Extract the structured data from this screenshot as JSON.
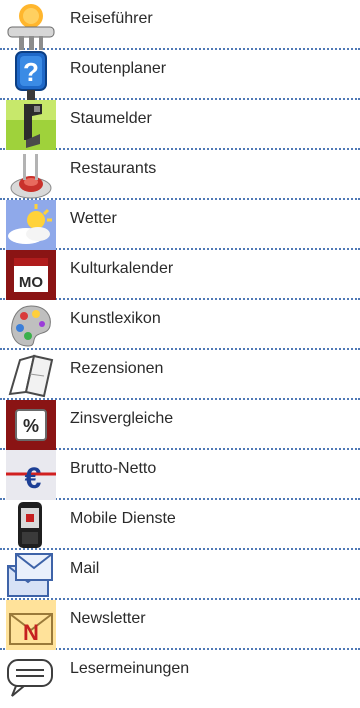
{
  "menu": {
    "items": [
      {
        "label": "Reiseführer",
        "icon": "beach-umbrella-icon"
      },
      {
        "label": "Routenplaner",
        "icon": "signpost-icon"
      },
      {
        "label": "Staumelder",
        "icon": "traffic-jam-icon"
      },
      {
        "label": "Restaurants",
        "icon": "plate-cutlery-icon"
      },
      {
        "label": "Wetter",
        "icon": "sun-cloud-icon"
      },
      {
        "label": "Kulturkalender",
        "icon": "calendar-icon"
      },
      {
        "label": "Kunstlexikon",
        "icon": "paint-palette-icon"
      },
      {
        "label": "Rezensionen",
        "icon": "open-book-icon"
      },
      {
        "label": "Zinsvergleiche",
        "icon": "percent-icon"
      },
      {
        "label": "Brutto-Netto",
        "icon": "euro-icon"
      },
      {
        "label": "Mobile Dienste",
        "icon": "mobile-phone-icon"
      },
      {
        "label": "Mail",
        "icon": "envelope-icon"
      },
      {
        "label": "Newsletter",
        "icon": "newsletter-icon"
      },
      {
        "label": "Lesermeinungen",
        "icon": "speech-bubble-icon"
      }
    ]
  },
  "colors": {
    "divider": "#4f79b6",
    "text": "#2a2a2a"
  }
}
